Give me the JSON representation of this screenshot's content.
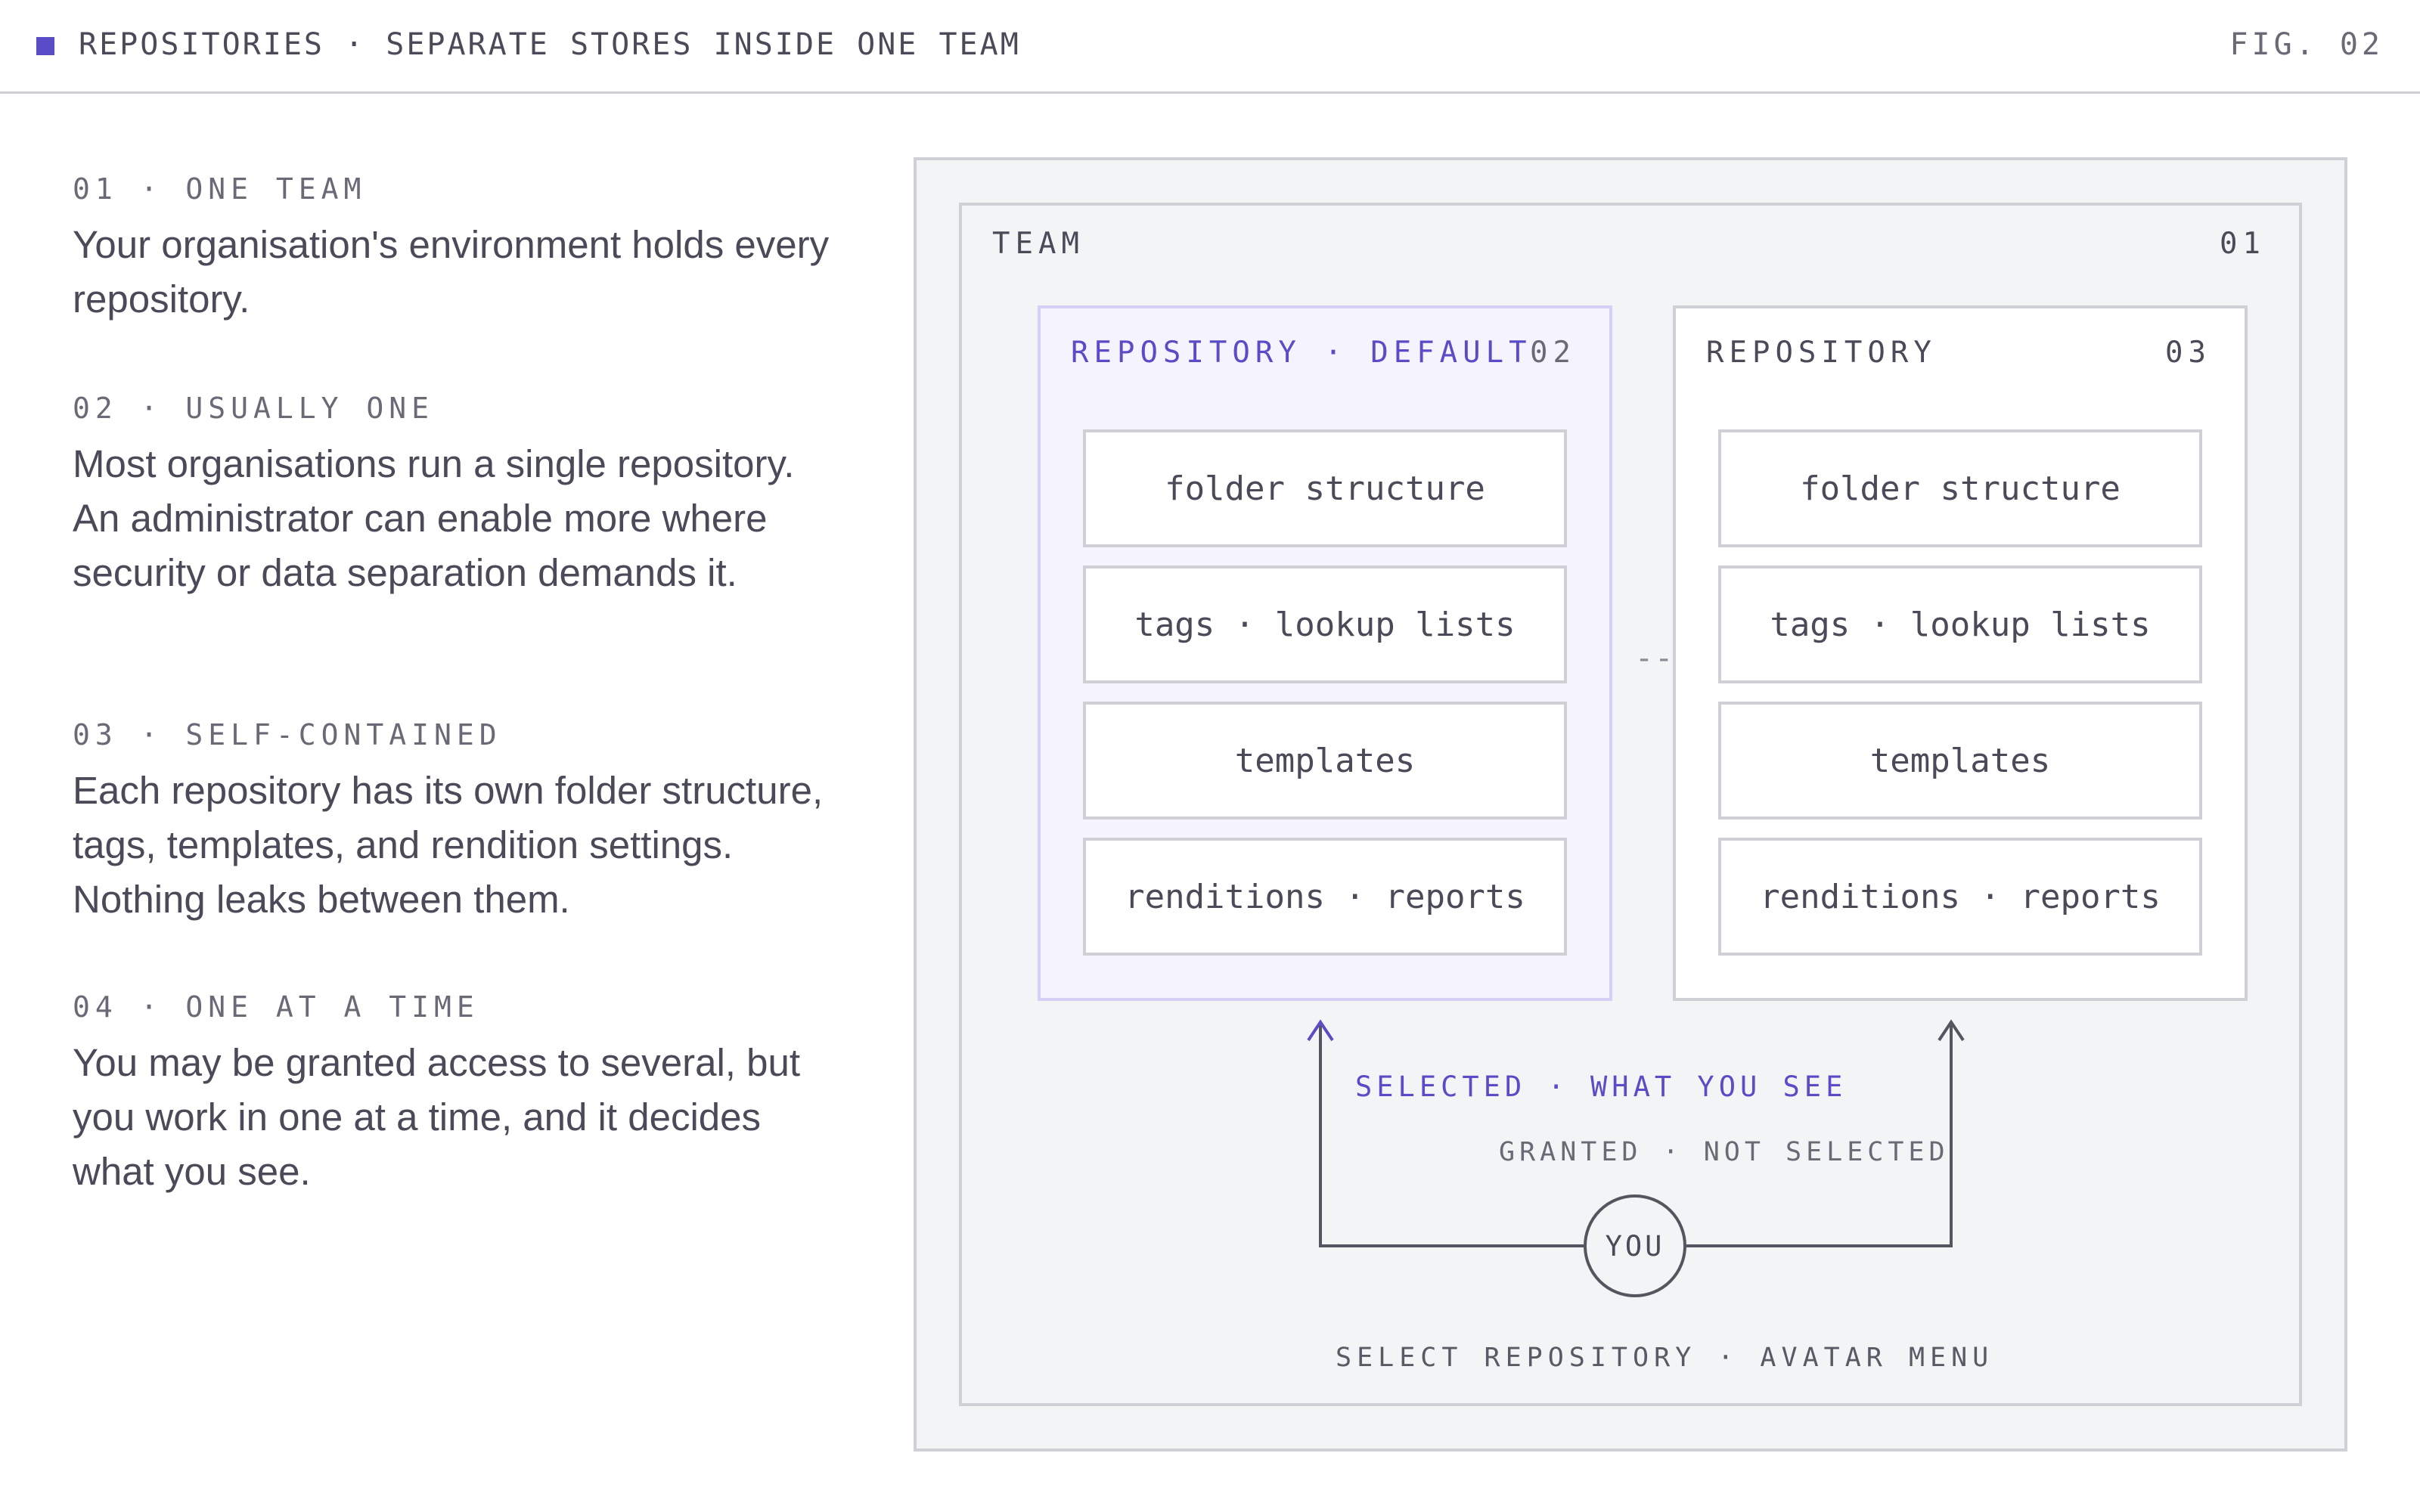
{
  "colors": {
    "accent": "#5a4bc6",
    "default_fill": "#f5f3fd",
    "default_border": "#d6d0f6",
    "panel_bg": "#f3f4f6",
    "border": "#cfcfd6",
    "text": "#4a4a58",
    "muted": "#6a6a76"
  },
  "header": {
    "title": "REPOSITORIES · SEPARATE STORES INSIDE ONE TEAM",
    "figure": "FIG. 02"
  },
  "notes": [
    {
      "label": "01 · ONE TEAM",
      "body": "Your organisation's environment holds every repository."
    },
    {
      "label": "02 · USUALLY ONE",
      "body": "Most organisations run a single repository. An administrator can enable more where security or data separation demands it."
    },
    {
      "label": "03 · SELF-CONTAINED",
      "body": "Each repository has its own folder structure, tags, templates, and rendition settings. Nothing leaks between them."
    },
    {
      "label": "04 · ONE AT A TIME",
      "body": "You may be granted access to several, but you work in one at a time, and it decides what you see."
    }
  ],
  "diagram": {
    "team": {
      "label": "TEAM",
      "number": "01"
    },
    "repositories": [
      {
        "label": "REPOSITORY · DEFAULT",
        "number": "02",
        "items": [
          "folder structure",
          "tags · lookup lists",
          "templates",
          "renditions · reports"
        ]
      },
      {
        "label": "REPOSITORY",
        "number": "03",
        "items": [
          "folder structure",
          "tags · lookup lists",
          "templates",
          "renditions · reports"
        ]
      }
    ],
    "separator": "---",
    "selected_label": "SELECTED · WHAT YOU SEE",
    "granted_label": "GRANTED · NOT SELECTED",
    "avatar_label": "YOU",
    "select_label": "SELECT REPOSITORY · AVATAR MENU"
  }
}
